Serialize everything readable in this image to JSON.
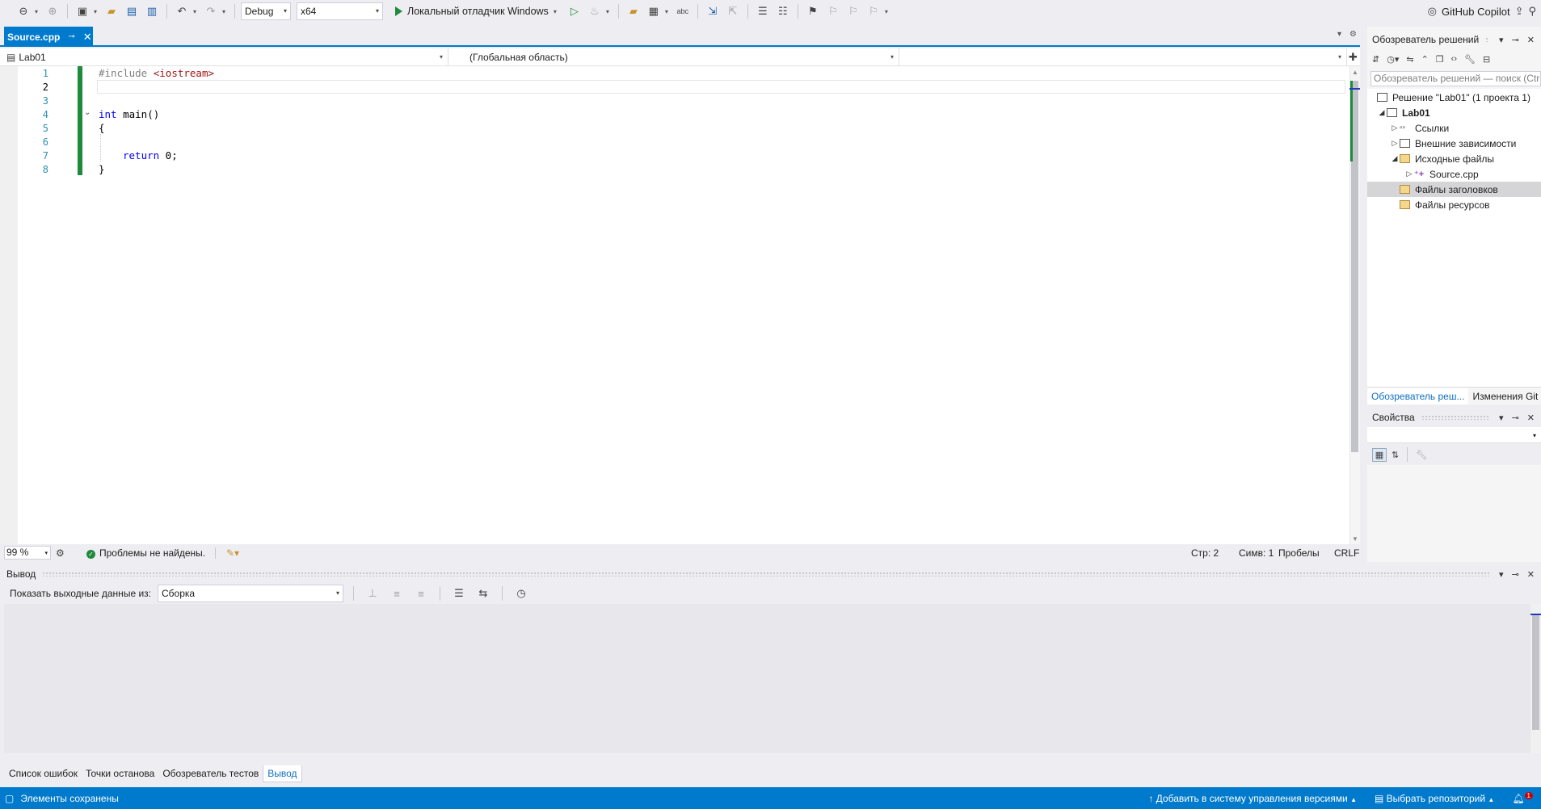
{
  "toolbar": {
    "configuration": "Debug",
    "platform": "x64",
    "run_label": "Локальный отладчик Windows",
    "copilot": "GitHub Copilot"
  },
  "doc_tab": {
    "title": "Source.cpp"
  },
  "navbar": {
    "project": "Lab01",
    "scope": "(Глобальная область)",
    "member": ""
  },
  "editor": {
    "line_numbers": [
      "1",
      "2",
      "3",
      "4",
      "5",
      "6",
      "7",
      "8"
    ],
    "current_line": 2,
    "code": {
      "l1_directive": "#include",
      "l1_header": "<iostream>",
      "l4_kw": "int",
      "l4_rest": " main()",
      "l5": "{",
      "l7_kw": "return",
      "l7_rest": " 0;",
      "l8": "}"
    }
  },
  "editor_status": {
    "zoom": "99 %",
    "issues": "Проблемы не найдены.",
    "line": "Стр: 2",
    "column": "Симв: 1",
    "whitespace": "Пробелы",
    "eol": "CRLF"
  },
  "output": {
    "title": "Вывод",
    "show_from_label": "Показать выходные данные из:",
    "source": "Сборка"
  },
  "bottom_tabs": [
    "Список ошибок",
    "Точки останова",
    "Обозреватель тестов",
    "Вывод"
  ],
  "bottom_tab_active": 3,
  "statusbar": {
    "left": "Элементы сохранены",
    "add_vcs": "Добавить в систему управления версиями",
    "select_repo": "Выбрать репозиторий",
    "notifications": "1"
  },
  "solution_explorer": {
    "title": "Обозреватель решений",
    "search_placeholder": "Обозреватель решений — поиск (Ctrl+;)",
    "tree": [
      {
        "label": "Решение \"Lab01\" (1 проекта 1)"
      },
      {
        "label": "Lab01"
      },
      {
        "label": "Ссылки"
      },
      {
        "label": "Внешние зависимости"
      },
      {
        "label": "Исходные файлы"
      },
      {
        "label": "Source.cpp"
      },
      {
        "label": "Файлы заголовков"
      },
      {
        "label": "Файлы ресурсов"
      }
    ],
    "tabs": [
      "Обозреватель реш...",
      "Изменения Git"
    ]
  },
  "properties": {
    "title": "Свойства"
  },
  "colors": {
    "accent": "#007acc",
    "green": "#1e8a3c",
    "keyword": "#0000ff",
    "string": "#a31515",
    "line_number": "#2b91af"
  }
}
